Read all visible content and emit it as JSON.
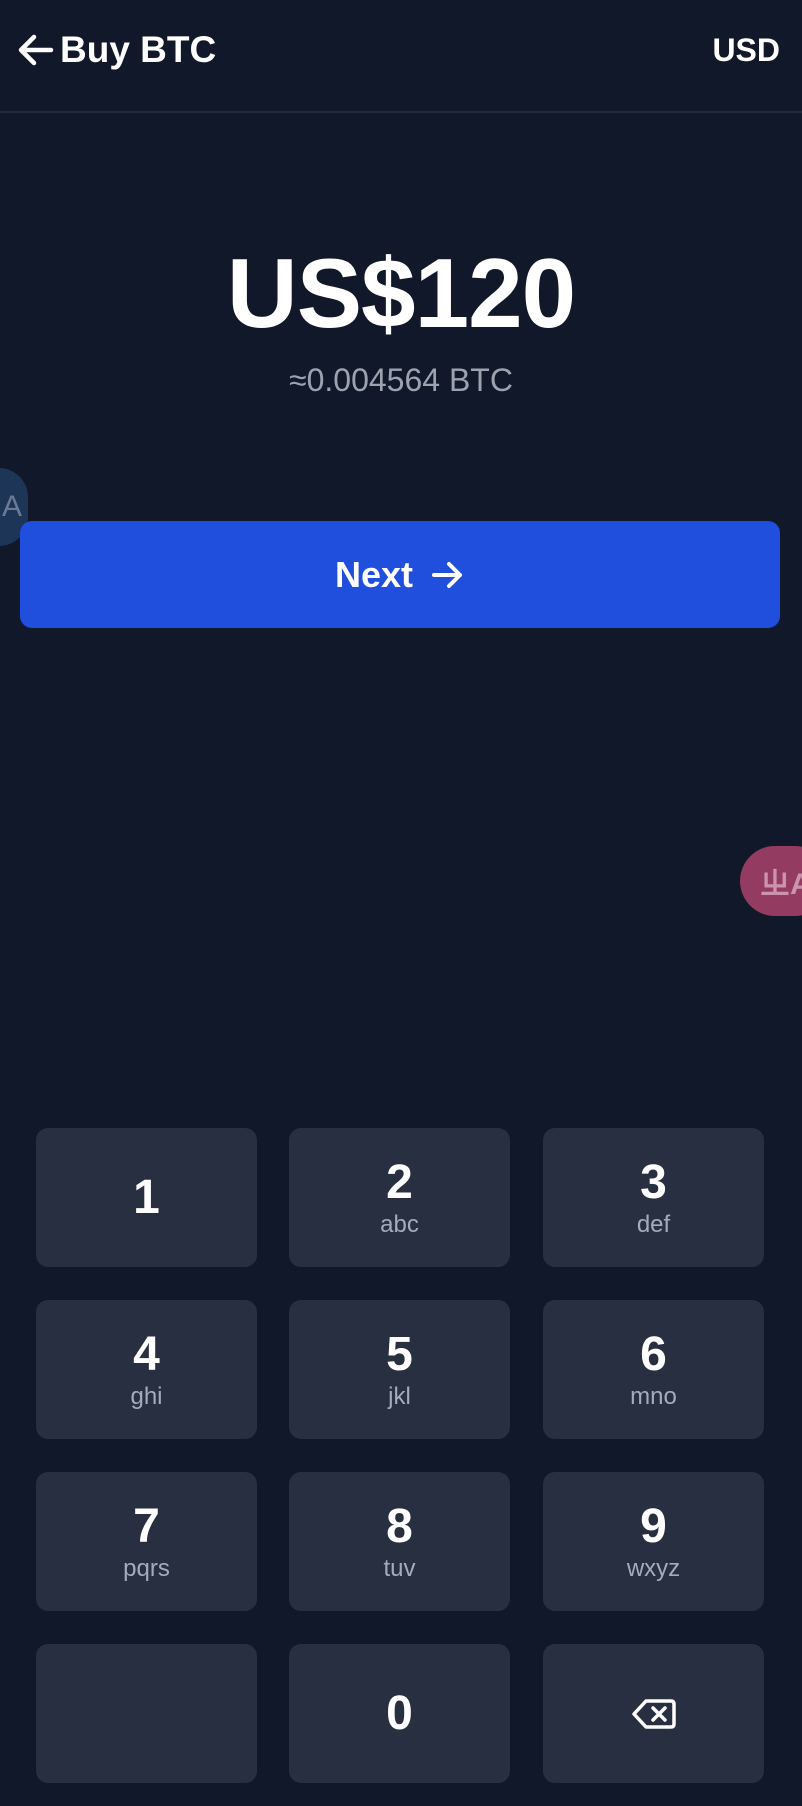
{
  "header": {
    "title": "Buy BTC",
    "currency": "USD"
  },
  "amount": {
    "fiat": "US$120",
    "crypto": "≈0.004564 BTC"
  },
  "next_button": {
    "label": "Next"
  },
  "floating": {
    "left_glyph": "A",
    "right_glyph": "ㄓA"
  },
  "keypad": {
    "k1": {
      "digit": "1",
      "letters": ""
    },
    "k2": {
      "digit": "2",
      "letters": "abc"
    },
    "k3": {
      "digit": "3",
      "letters": "def"
    },
    "k4": {
      "digit": "4",
      "letters": "ghi"
    },
    "k5": {
      "digit": "5",
      "letters": "jkl"
    },
    "k6": {
      "digit": "6",
      "letters": "mno"
    },
    "k7": {
      "digit": "7",
      "letters": "pqrs"
    },
    "k8": {
      "digit": "8",
      "letters": "tuv"
    },
    "k9": {
      "digit": "9",
      "letters": "wxyz"
    },
    "k0": {
      "digit": "0",
      "letters": ""
    },
    "backspace_icon": "backspace-icon"
  },
  "colors": {
    "background": "#111829",
    "key": "#282f40",
    "accent": "#1f4fdc",
    "muted_text": "#9ca3af"
  }
}
